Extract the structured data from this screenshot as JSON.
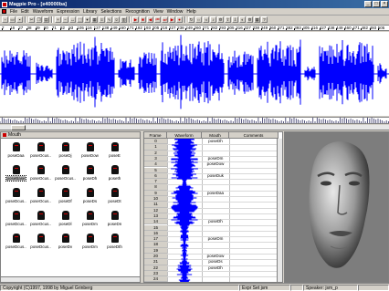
{
  "titlebar": {
    "title": "Magpie Pro - [e40000ba]",
    "min": "_",
    "max": "□",
    "close": "×"
  },
  "menu": [
    "File",
    "Edit",
    "Waveform",
    "Expression",
    "Library",
    "Selections",
    "Recognition",
    "View",
    "Window",
    "Help"
  ],
  "ruler": [
    "7",
    "16",
    "27",
    "38",
    "49",
    "60",
    "71",
    "82",
    "93",
    "105",
    "116",
    "127",
    "138",
    "149",
    "160",
    "171",
    "182",
    "193",
    "205",
    "216",
    "227",
    "238",
    "249",
    "260",
    "271",
    "282",
    "293",
    "305",
    "316",
    "327",
    "338",
    "349",
    "360",
    "371",
    "382",
    "393",
    "405",
    "416",
    "427",
    "438",
    "449",
    "460",
    "471",
    "482",
    "493",
    "505"
  ],
  "library": {
    "header": "Mouth",
    "items": [
      "poseDaa",
      "poseOcus..",
      "poseDj",
      "poseDow",
      "poseE",
      "poseBase",
      "poseOcus..",
      "poseOcus..",
      "poseDh",
      "poseth",
      "poseDcus..",
      "poseOcus..",
      "poseDf",
      "poseDs",
      "poseDt",
      "poseDcus..",
      "poseOcus..",
      "poseDl",
      "poseDm",
      "poseDn",
      "poseDcus..",
      "poseDcus..",
      "poseDv",
      "poseDm",
      "poseDth"
    ],
    "selected_index": 5
  },
  "table": {
    "headers": [
      "Frame",
      "Waveform",
      "Mouth",
      "Comments"
    ],
    "frames": [
      "0",
      "1",
      "2",
      "3",
      "4",
      "5",
      "6",
      "7",
      "8",
      "9",
      "10",
      "11",
      "12",
      "13",
      "14",
      "15",
      "16",
      "17",
      "18",
      "19",
      "20",
      "21",
      "22",
      "23",
      "24"
    ],
    "mouth": [
      {
        "row": 0,
        "label": "poseDh"
      },
      {
        "row": 3,
        "label": "poseDm"
      },
      {
        "row": 4,
        "label": "poseDow"
      },
      {
        "row": 6,
        "label": "poseDuk"
      },
      {
        "row": 9,
        "label": "poseDaa"
      },
      {
        "row": 14,
        "label": "poseDh"
      },
      {
        "row": 17,
        "label": "poseDm"
      },
      {
        "row": 20,
        "label": "poseDow"
      },
      {
        "row": 21,
        "label": "poseDs"
      },
      {
        "row": 22,
        "label": "poseDh"
      }
    ]
  },
  "status": {
    "copyright": "Copyright (C)1997, 1998 by Miguel Grinberg",
    "expr": "Expr Set jsm",
    "speaker": "Speaker: jsm_p"
  },
  "colors": {
    "waveform": "#0000ff",
    "titlebar": "#0a246a",
    "face_bg": "#7d7d7d"
  }
}
